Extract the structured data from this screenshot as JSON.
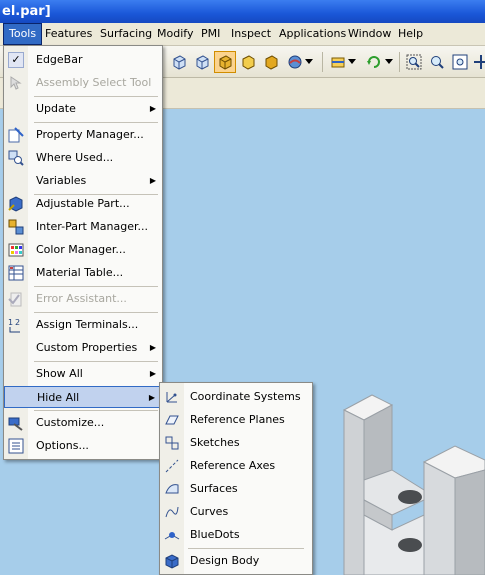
{
  "window": {
    "title": "el.par]"
  },
  "menubar": {
    "items": [
      "Tools",
      "Features",
      "Surfacing",
      "Modify",
      "PMI",
      "Inspect",
      "Applications",
      "Window",
      "Help"
    ]
  },
  "tools_menu": {
    "items": [
      {
        "label": "EdgeBar",
        "checked": true,
        "enabled": true,
        "submenu": false
      },
      {
        "label": "Assembly Select Tool",
        "enabled": false,
        "submenu": false
      },
      {
        "label": "Update",
        "enabled": true,
        "submenu": true
      },
      {
        "label": "Property Manager...",
        "enabled": true,
        "submenu": false
      },
      {
        "label": "Where Used...",
        "enabled": true,
        "submenu": false
      },
      {
        "label": "Variables",
        "enabled": true,
        "submenu": true
      },
      {
        "label": "Adjustable Part...",
        "enabled": true,
        "submenu": false
      },
      {
        "label": "Inter-Part Manager...",
        "enabled": true,
        "submenu": false
      },
      {
        "label": "Color Manager...",
        "enabled": true,
        "submenu": false
      },
      {
        "label": "Material Table...",
        "enabled": true,
        "submenu": false
      },
      {
        "label": "Error Assistant...",
        "enabled": false,
        "submenu": false
      },
      {
        "label": "Assign Terminals...",
        "enabled": true,
        "submenu": false
      },
      {
        "label": "Custom Properties",
        "enabled": true,
        "submenu": true
      },
      {
        "label": "Show All",
        "enabled": true,
        "submenu": true
      },
      {
        "label": "Hide All",
        "enabled": true,
        "submenu": true,
        "highlighted": true
      },
      {
        "label": "Customize...",
        "enabled": true,
        "submenu": false
      },
      {
        "label": "Options...",
        "enabled": true,
        "submenu": false
      }
    ]
  },
  "hide_all_submenu": {
    "items": [
      "Coordinate Systems",
      "Reference Planes",
      "Sketches",
      "Reference Axes",
      "Surfaces",
      "Curves",
      "BlueDots",
      "Design Body"
    ]
  },
  "colors": {
    "title_bar": "#1a57d8",
    "menu_highlight": "#316ac5",
    "viewport_background": "#a6cdea",
    "selected_toolbar_button": "#fbd38e"
  }
}
